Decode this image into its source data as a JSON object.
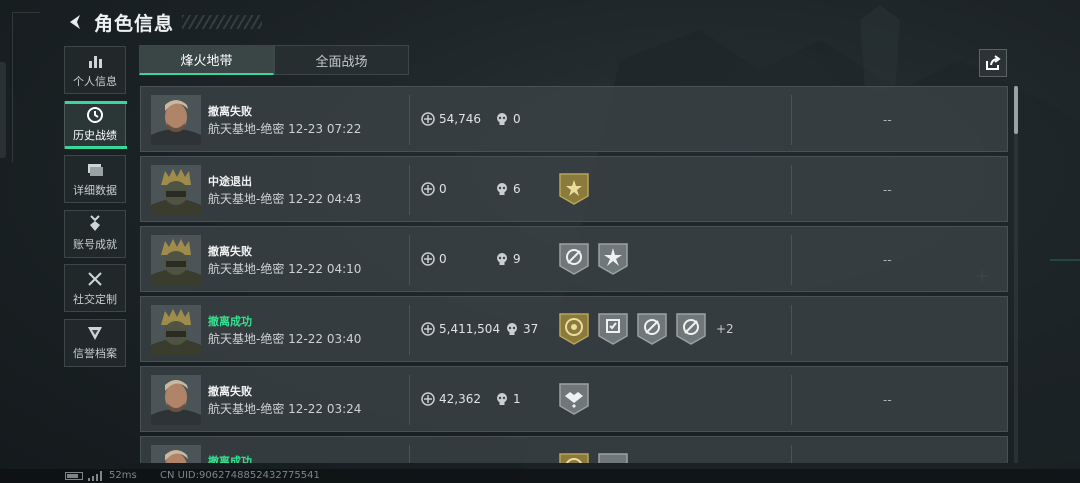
{
  "header": {
    "title": "角色信息",
    "back_icon": "back-arrow-icon"
  },
  "sidebar": {
    "items": [
      {
        "label": "个人信息",
        "icon": "bar-chart-icon",
        "active": false
      },
      {
        "label": "历史战绩",
        "icon": "history-clock-icon",
        "active": true
      },
      {
        "label": "详细数据",
        "icon": "stacked-cards-icon",
        "active": false
      },
      {
        "label": "账号成就",
        "icon": "medal-icon",
        "active": false
      },
      {
        "label": "社交定制",
        "icon": "tools-icon",
        "active": false
      },
      {
        "label": "信誉档案",
        "icon": "shield-icon",
        "active": false
      }
    ]
  },
  "tabs": [
    {
      "label": "烽火地带",
      "active": true
    },
    {
      "label": "全面战场",
      "active": false
    }
  ],
  "share_icon": "share-icon",
  "colors": {
    "accent": "#3ad69a",
    "success_text": "#35e08f",
    "gold_badge": "#8a7a3c",
    "gray_badge": "#6f7779"
  },
  "records": [
    {
      "outcome": "撤离失败",
      "success": false,
      "location": "航天基地-绝密",
      "time": "12-23 07:22",
      "value": "54,746",
      "kills": "0",
      "badges": [],
      "more": "",
      "extra": "--",
      "portrait": "bearded-operator"
    },
    {
      "outcome": "中途退出",
      "success": false,
      "location": "航天基地-绝密",
      "time": "12-22 04:43",
      "value": "0",
      "kills": "6",
      "badges": [
        "gold-star-badge"
      ],
      "more": "",
      "extra": "--",
      "portrait": "helmet-operator"
    },
    {
      "outcome": "撤离失败",
      "success": false,
      "location": "航天基地-绝密",
      "time": "12-22 04:10",
      "value": "0",
      "kills": "9",
      "badges": [
        "gray-crosshair-badge",
        "gray-star-badge"
      ],
      "more": "",
      "extra": "--",
      "portrait": "helmet-operator"
    },
    {
      "outcome": "撤离成功",
      "success": true,
      "location": "航天基地-绝密",
      "time": "12-22 03:40",
      "value": "5,411,504",
      "kills": "37",
      "badges": [
        "gold-ring-badge",
        "gray-shield-badge",
        "gray-crosshair-badge",
        "gray-crosshair-badge"
      ],
      "more": "+2",
      "extra": "",
      "portrait": "helmet-operator"
    },
    {
      "outcome": "撤离失败",
      "success": false,
      "location": "航天基地-绝密",
      "time": "12-22 03:24",
      "value": "42,362",
      "kills": "1",
      "badges": [
        "gray-handshake-badge"
      ],
      "more": "",
      "extra": "--",
      "portrait": "bearded-operator"
    },
    {
      "outcome": "撤离成功",
      "success": true,
      "location": "",
      "time": "",
      "value": "",
      "kills": "",
      "badges": [
        "gold-ring-badge",
        "gray-shield-badge"
      ],
      "more": "",
      "extra": "",
      "portrait": "bearded-operator"
    }
  ],
  "footer": {
    "ping": "52ms",
    "uid": "CN UID:9062748852432775541"
  }
}
